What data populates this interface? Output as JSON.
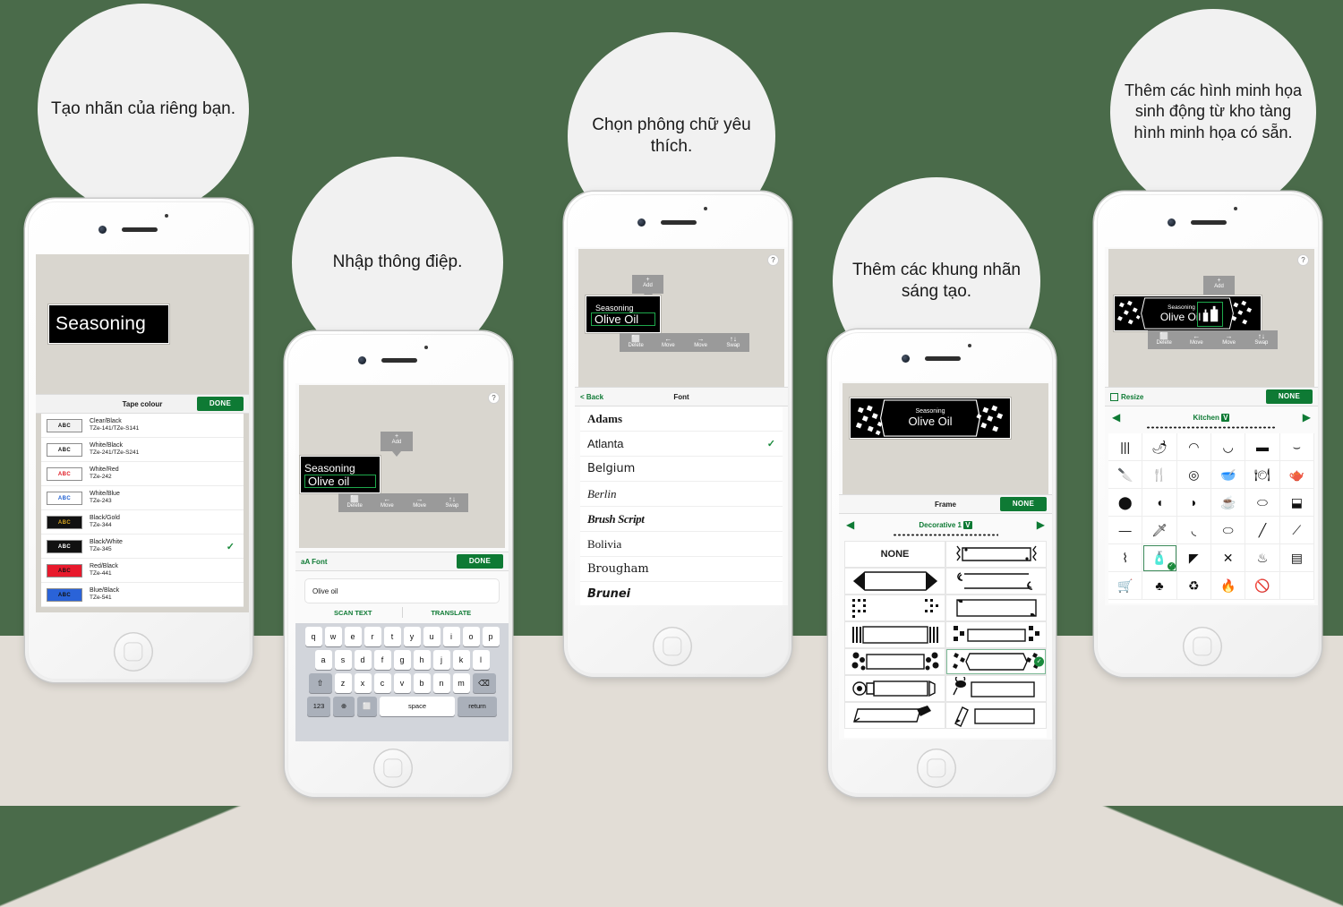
{
  "theme": {
    "bg_green": "#4a6b4a",
    "floor_beige": "#e2ddd6",
    "bubble_grey": "#f1f1f1",
    "brand_green": "#0e7a34",
    "canvas_grey": "#d9d6cf"
  },
  "bubbles": [
    {
      "id": "bubble-1",
      "text": "Tạo nhãn của riêng bạn."
    },
    {
      "id": "bubble-2",
      "text": "Nhập thông điệp."
    },
    {
      "id": "bubble-3",
      "text": "Chọn phông chữ yêu thích."
    },
    {
      "id": "bubble-4",
      "text": "Thêm các khung nhãn sáng tạo."
    },
    {
      "id": "bubble-5",
      "text": "Thêm các hình minh họa sinh động từ kho tàng hình minh họa có sẵn."
    }
  ],
  "phone1": {
    "preview_text": "Seasoning",
    "header_title": "Tape colour",
    "done_label": "DONE",
    "swatch_label": "ABC",
    "tape_colours": [
      {
        "name": "Clear/Black",
        "code": "TZe-141/TZe-S141",
        "bg": "#f2f2f2",
        "fg": "#111111",
        "selected": false
      },
      {
        "name": "White/Black",
        "code": "TZe-241/TZe-S241",
        "bg": "#ffffff",
        "fg": "#111111",
        "selected": false
      },
      {
        "name": "White/Red",
        "code": "TZe-242",
        "bg": "#ffffff",
        "fg": "#e01b24",
        "selected": false
      },
      {
        "name": "White/Blue",
        "code": "TZe-243",
        "bg": "#ffffff",
        "fg": "#1f5fd0",
        "selected": false
      },
      {
        "name": "Black/Gold",
        "code": "TZe-344",
        "bg": "#111111",
        "fg": "#d8a520",
        "selected": false
      },
      {
        "name": "Black/White",
        "code": "TZe-345",
        "bg": "#111111",
        "fg": "#ffffff",
        "selected": true
      },
      {
        "name": "Red/Black",
        "code": "TZe-441",
        "bg": "#e8192c",
        "fg": "#111111",
        "selected": false
      },
      {
        "name": "Blue/Black",
        "code": "TZe-541",
        "bg": "#2a63d8",
        "fg": "#111111",
        "selected": false
      }
    ],
    "check_glyph": "✓"
  },
  "phone2": {
    "help_glyph": "?",
    "add_label": "Add",
    "add_plus": "+",
    "label_line1": "Seasoning",
    "label_line2": "Olive oil",
    "tools": [
      {
        "glyph": "⬜",
        "label": "Delete",
        "icon": "trash-icon"
      },
      {
        "glyph": "←",
        "label": "Move",
        "icon": "arrow-left-icon"
      },
      {
        "glyph": "→",
        "label": "Move",
        "icon": "arrow-right-icon"
      },
      {
        "glyph": "↑↓",
        "label": "Swap",
        "icon": "swap-icon"
      }
    ],
    "font_button": "Font",
    "font_button_icon": "aA",
    "done_label": "DONE",
    "input_value": "Olive oil",
    "scan_text_label": "SCAN TEXT",
    "translate_label": "TRANSLATE",
    "keyboard": {
      "row1": [
        "q",
        "w",
        "e",
        "r",
        "t",
        "y",
        "u",
        "i",
        "o",
        "p"
      ],
      "row2": [
        "a",
        "s",
        "d",
        "f",
        "g",
        "h",
        "j",
        "k",
        "l"
      ],
      "row3": [
        "z",
        "x",
        "c",
        "v",
        "b",
        "n",
        "m"
      ],
      "shift_glyph": "⇧",
      "backspace_glyph": "⌫",
      "numbers_label": "123",
      "globe_glyph": "⊕",
      "mic_glyph": "⬜",
      "space_label": "space",
      "return_label": "return"
    }
  },
  "phone3": {
    "help_glyph": "?",
    "add_label": "Add",
    "add_plus": "+",
    "label_line1": "Seasoning",
    "label_line2": "Olive Oil",
    "tools": [
      {
        "glyph": "⬜",
        "label": "Delete"
      },
      {
        "glyph": "←",
        "label": "Move"
      },
      {
        "glyph": "→",
        "label": "Move"
      },
      {
        "glyph": "↑↓",
        "label": "Swap"
      }
    ],
    "back_label": "< Back",
    "section_title": "Font",
    "check_glyph": "✓",
    "fonts": [
      {
        "name": "Adams",
        "style": "serif-bold",
        "selected": false
      },
      {
        "name": "Atlanta",
        "style": "sans",
        "selected": true
      },
      {
        "name": "Belgium",
        "style": "sans-round",
        "selected": false
      },
      {
        "name": "Berlin",
        "style": "serif-italic",
        "selected": false
      },
      {
        "name": "Brush Script",
        "style": "script",
        "selected": false
      },
      {
        "name": "Bolivia",
        "style": "serif",
        "selected": false
      },
      {
        "name": "Brougham",
        "style": "slab",
        "selected": false
      },
      {
        "name": "Brunei",
        "style": "sans-bold-italic",
        "selected": false
      }
    ]
  },
  "phone4": {
    "label_line1": "Seasoning",
    "label_line2": "Olive Oil",
    "section_title": "Frame",
    "none_button": "NONE",
    "category": "Decorative 1",
    "category_badge": "V",
    "prev_glyph": "◀",
    "next_glyph": "▶",
    "none_cell_label": "NONE",
    "frames": [
      {
        "id": "frame-none",
        "kind": "none",
        "selected": false
      },
      {
        "id": "frame-squiggle",
        "kind": "squiggle",
        "selected": false
      },
      {
        "id": "frame-arrow",
        "kind": "arrow",
        "selected": false
      },
      {
        "id": "frame-swirl",
        "kind": "swirl",
        "selected": false
      },
      {
        "id": "frame-pixdots",
        "kind": "pixdots",
        "selected": false
      },
      {
        "id": "frame-corner",
        "kind": "corner",
        "selected": false
      },
      {
        "id": "frame-stripes",
        "kind": "stripes",
        "selected": false
      },
      {
        "id": "frame-checker",
        "kind": "checker",
        "selected": false
      },
      {
        "id": "frame-flowers",
        "kind": "flowers",
        "selected": false
      },
      {
        "id": "frame-snow",
        "kind": "snow",
        "selected": true
      },
      {
        "id": "frame-tube",
        "kind": "tube",
        "selected": false
      },
      {
        "id": "frame-bee",
        "kind": "bee",
        "selected": false
      },
      {
        "id": "frame-pen",
        "kind": "pen",
        "selected": false
      },
      {
        "id": "frame-pencil",
        "kind": "pencil",
        "selected": false
      }
    ]
  },
  "phone5": {
    "help_glyph": "?",
    "add_label": "Add",
    "add_plus": "+",
    "label_line1": "Seasoning",
    "label_line2": "Olive Oil",
    "tools": [
      {
        "glyph": "⬜",
        "label": "Delete"
      },
      {
        "glyph": "←",
        "label": "Move"
      },
      {
        "glyph": "→",
        "label": "Move"
      },
      {
        "glyph": "↑↓",
        "label": "Swap"
      }
    ],
    "resize_label": "Resize",
    "none_button": "NONE",
    "category": "Kitchen",
    "category_badge": "V",
    "prev_glyph": "◀",
    "next_glyph": "▶",
    "symbols": [
      {
        "n": "chopsticks-icon",
        "g": "|||"
      },
      {
        "n": "chilli-icon",
        "g": "🌶"
      },
      {
        "n": "watermelon-icon",
        "g": "◠"
      },
      {
        "n": "bread-icon",
        "g": "◡"
      },
      {
        "n": "chocolate-icon",
        "g": "▬"
      },
      {
        "n": "bowl-icon",
        "g": "⌣"
      },
      {
        "n": "knife-icon",
        "g": "🔪"
      },
      {
        "n": "fork-icon",
        "g": "🍴"
      },
      {
        "n": "plates-icon",
        "g": "◎"
      },
      {
        "n": "mixing-bowl-icon",
        "g": "🥣"
      },
      {
        "n": "place-setting-icon",
        "g": "🍽"
      },
      {
        "n": "teapot-icon",
        "g": "🫖"
      },
      {
        "n": "sugar-pot-icon",
        "g": "⬤"
      },
      {
        "n": "gravy-boat-icon",
        "g": "◖"
      },
      {
        "n": "kettle-icon",
        "g": "◗"
      },
      {
        "n": "teacup-icon",
        "g": "☕"
      },
      {
        "n": "cake-icon",
        "g": "⬭"
      },
      {
        "n": "tofu-box-icon",
        "g": "⬓"
      },
      {
        "n": "rolling-pin-icon",
        "g": "—"
      },
      {
        "n": "chef-knife-icon",
        "g": "🗡"
      },
      {
        "n": "ladle-icon",
        "g": "◟"
      },
      {
        "n": "dish-icon",
        "g": "⬭"
      },
      {
        "n": "spatula-knife-icon",
        "g": "╱"
      },
      {
        "n": "turner-icon",
        "g": "⟋"
      },
      {
        "n": "whisk-icon",
        "g": "⌇"
      },
      {
        "n": "bottles-icon",
        "g": "🧴"
      },
      {
        "n": "pouring-icon",
        "g": "◤"
      },
      {
        "n": "crossed-utensils-icon",
        "g": "✕"
      },
      {
        "n": "hot-soup-icon",
        "g": "♨"
      },
      {
        "n": "coffee-machine-icon",
        "g": "▤"
      },
      {
        "n": "shopping-cart-icon",
        "g": "🛒"
      },
      {
        "n": "chef-hat-icon",
        "g": "♣"
      },
      {
        "n": "recycle-icon",
        "g": "♻"
      },
      {
        "n": "flame-icon",
        "g": "🔥"
      },
      {
        "n": "no-flame-icon",
        "g": "🚫"
      },
      {
        "n": "empty-icon",
        "g": ""
      }
    ],
    "selected_symbol_index": 25
  }
}
